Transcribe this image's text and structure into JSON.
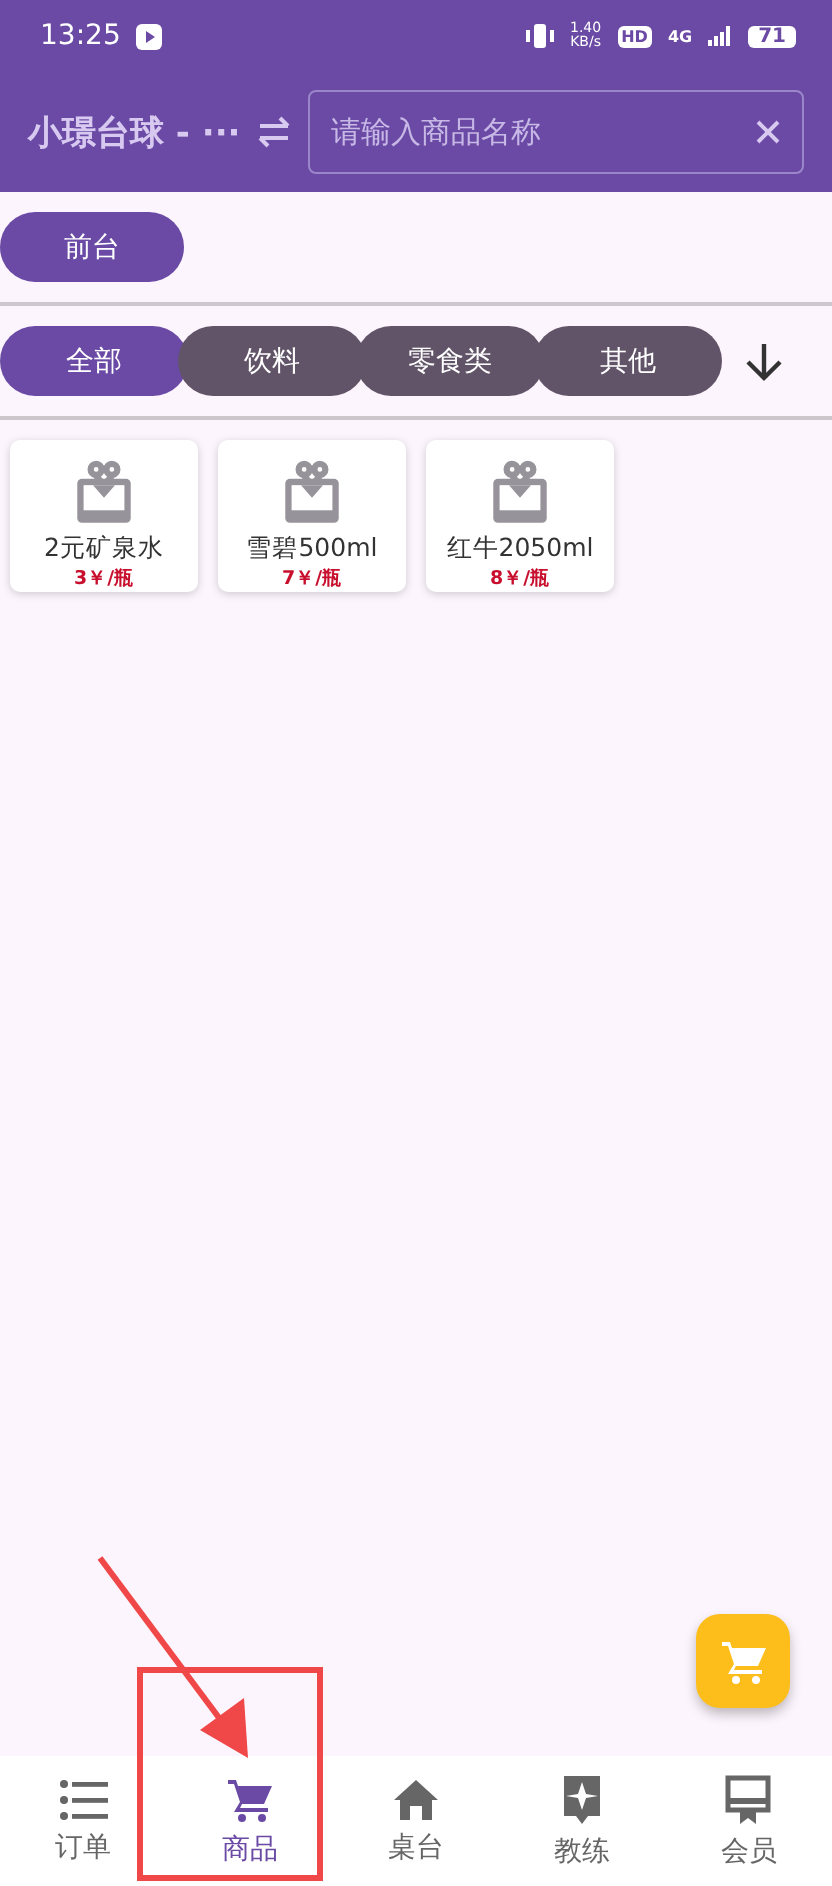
{
  "status_bar": {
    "time": "13:25",
    "speed": "1.40",
    "speed_unit": "KB/s",
    "hd": "HD",
    "network": "4G",
    "battery": "71"
  },
  "header": {
    "title": "小璟台球 - ···",
    "search": {
      "placeholder": "请输入商品名称"
    }
  },
  "counters": [
    {
      "label": "前台",
      "selected": true
    }
  ],
  "categories": [
    {
      "label": "全部",
      "selected": true
    },
    {
      "label": "饮料",
      "selected": false
    },
    {
      "label": "零食类",
      "selected": false
    },
    {
      "label": "其他",
      "selected": false
    }
  ],
  "products": [
    {
      "name": "2元矿泉水",
      "price": "3￥/瓶"
    },
    {
      "name": "雪碧500ml",
      "price": "7￥/瓶"
    },
    {
      "name": "红牛2050ml",
      "price": "8￥/瓶"
    }
  ],
  "bottom_nav": [
    {
      "label": "订单",
      "kind": "list",
      "selected": false
    },
    {
      "label": "商品",
      "kind": "cart",
      "selected": true
    },
    {
      "label": "桌台",
      "kind": "home",
      "selected": false
    },
    {
      "label": "教练",
      "kind": "coach",
      "selected": false
    },
    {
      "label": "会员",
      "kind": "member",
      "selected": false
    }
  ]
}
